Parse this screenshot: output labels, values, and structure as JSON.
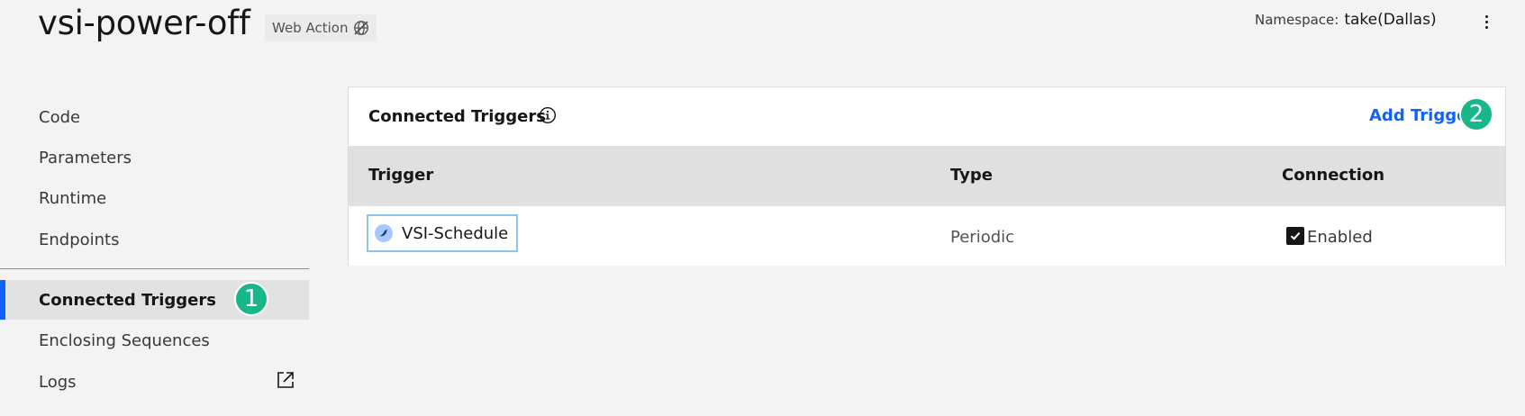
{
  "header": {
    "title": "vsi-power-off",
    "web_action_label": "Web Action",
    "namespace_label": "Namespace:",
    "namespace_value": "take(Dallas)"
  },
  "sidebar": {
    "items": [
      {
        "label": "Code"
      },
      {
        "label": "Parameters"
      },
      {
        "label": "Runtime"
      },
      {
        "label": "Endpoints"
      },
      {
        "label": "Connected Triggers",
        "active": true
      },
      {
        "label": "Enclosing Sequences"
      },
      {
        "label": "Logs"
      }
    ]
  },
  "badges": {
    "one": "1",
    "two": "2"
  },
  "panel": {
    "title": "Connected Triggers",
    "add_trigger_label": "Add Trigger",
    "columns": [
      "Trigger",
      "Type",
      "Connection"
    ],
    "rows": [
      {
        "trigger": "VSI-Schedule",
        "type": "Periodic",
        "connection": "Enabled",
        "checked": true
      }
    ]
  },
  "colors": {
    "accent": "#0f62fe",
    "badge": "#17b78a",
    "background": "#f3f3f3"
  }
}
